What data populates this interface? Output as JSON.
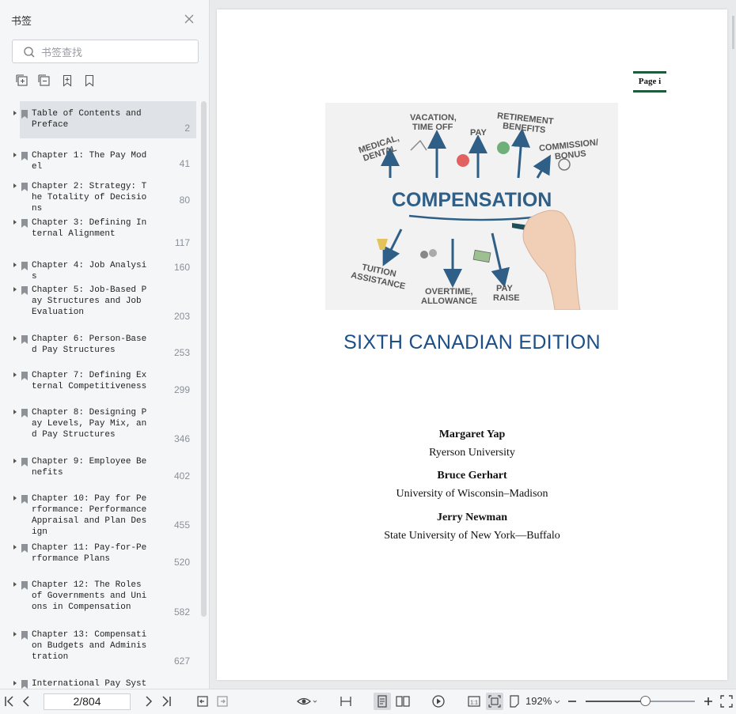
{
  "sidebar": {
    "title": "书签",
    "search_placeholder": "书签查找",
    "items": [
      {
        "label": "Table of Contents and Preface",
        "page": "2"
      },
      {
        "label": "Chapter 1: The Pay Model",
        "page": "41"
      },
      {
        "label": "Chapter 2: Strategy: The Totality of Decisions",
        "page": "80"
      },
      {
        "label": "Chapter 3: Defining Internal Alignment",
        "page": "117"
      },
      {
        "label": "Chapter 4: Job Analysis",
        "page": "160"
      },
      {
        "label": "Chapter 5: Job-Based Pay Structures and Job Evaluation",
        "page": "203"
      },
      {
        "label": "Chapter 6: Person-Based Pay Structures",
        "page": "253"
      },
      {
        "label": "Chapter 7: Defining External Competitiveness",
        "page": "299"
      },
      {
        "label": "Chapter 8: Designing Pay Levels, Pay Mix, and Pay Structures",
        "page": "346"
      },
      {
        "label": "Chapter 9: Employee Benefits",
        "page": "402"
      },
      {
        "label": "Chapter 10: Pay for Performance: Performance Appraisal and Plan Design",
        "page": "455"
      },
      {
        "label": "Chapter 11: Pay-for-Performance Plans",
        "page": "520"
      },
      {
        "label": "Chapter 12: The Roles of Governments and Unions in Compensation",
        "page": "582"
      },
      {
        "label": "Chapter 13: Compensation Budgets and Administration",
        "page": "627"
      },
      {
        "label": "International Pay System",
        "page": ""
      }
    ]
  },
  "document": {
    "page_tag": "Page i",
    "cover_words": {
      "center": "COMPENSATION",
      "medical": "MEDICAL,",
      "dental": "DENTAL",
      "vacation": "VACATION,",
      "time_off": "TIME OFF",
      "pay": "PAY",
      "retirement": "RETIREMENT",
      "benefits": "BENEFITS",
      "commission": "COMMISSION/",
      "bonus": "BONUS",
      "tuition": "TUITION",
      "assistance": "ASSISTANCE",
      "overtime": "OVERTIME,",
      "allowance": "ALLOWANCE",
      "pay_raise_1": "PAY",
      "pay_raise_2": "RAISE"
    },
    "edition": "SIXTH CANADIAN EDITION",
    "authors": [
      {
        "name": "Margaret Yap",
        "affiliation": "Ryerson University"
      },
      {
        "name": "Bruce Gerhart",
        "affiliation": "University of Wisconsin–Madison"
      },
      {
        "name": "Jerry Newman",
        "affiliation": "State University of New York—Buffalo"
      }
    ]
  },
  "toolbar": {
    "page_indicator": "2/804",
    "zoom": "192%",
    "zoom_slider_fraction": 0.55
  },
  "colors": {
    "accent_blue": "#1d4f86",
    "page_tag_green": "#1f5b3a",
    "cover_arrow": "#2f5f86"
  }
}
